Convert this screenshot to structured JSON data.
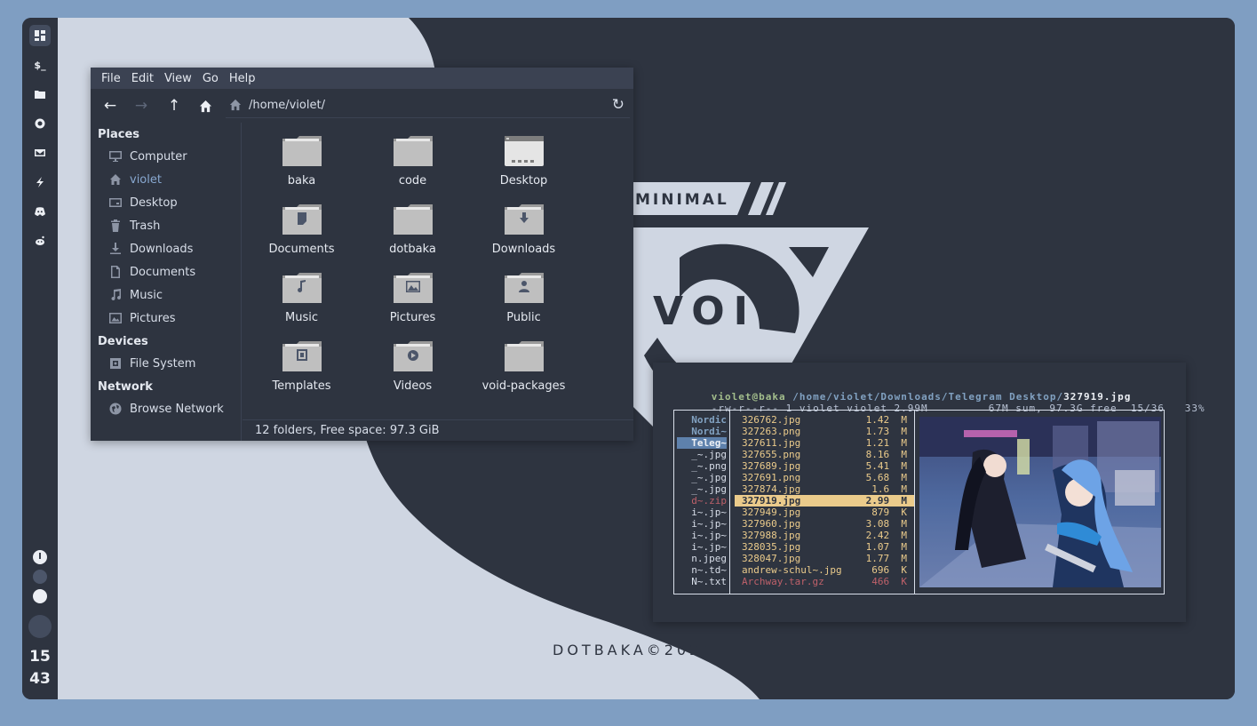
{
  "colors": {
    "frame": "#7f9ec2",
    "panel": "#2e3440",
    "light": "#cfd6e2",
    "accent": "#88a8d0",
    "yellow": "#ebcb8b",
    "red": "#bf616a"
  },
  "bar": {
    "buttons": [
      {
        "icon": "dashboard-icon"
      },
      {
        "icon": "terminal-icon",
        "text": "$_"
      },
      {
        "icon": "folder-icon"
      },
      {
        "icon": "settings-icon"
      },
      {
        "icon": "mail-icon"
      },
      {
        "icon": "bolt-icon"
      },
      {
        "icon": "discord-icon"
      },
      {
        "icon": "reddit-icon"
      }
    ],
    "status_icon": "I",
    "clock_hour": "15",
    "clock_minute": "43"
  },
  "wallpaper": {
    "tagline": "MINIMAL",
    "logo_text": "VOID",
    "credit": "DOTBAKA©2021"
  },
  "fm": {
    "menu": [
      "File",
      "Edit",
      "View",
      "Go",
      "Help"
    ],
    "toolbar": {
      "back": "←",
      "forward": "→",
      "up": "↑",
      "reload": "↻"
    },
    "path": "/home/violet/",
    "sidebar": {
      "places_label": "Places",
      "places": [
        {
          "label": "Computer",
          "icon": "computer-icon"
        },
        {
          "label": "violet",
          "icon": "home-icon"
        },
        {
          "label": "Desktop",
          "icon": "desktop-icon"
        },
        {
          "label": "Trash",
          "icon": "trash-icon"
        },
        {
          "label": "Downloads",
          "icon": "download-icon"
        },
        {
          "label": "Documents",
          "icon": "document-icon"
        },
        {
          "label": "Music",
          "icon": "music-icon"
        },
        {
          "label": "Pictures",
          "icon": "picture-icon"
        }
      ],
      "devices_label": "Devices",
      "devices": [
        {
          "label": "File System",
          "icon": "drive-icon"
        }
      ],
      "network_label": "Network",
      "network": [
        {
          "label": "Browse Network",
          "icon": "network-icon"
        }
      ]
    },
    "folders": [
      {
        "name": "baka",
        "emblem": ""
      },
      {
        "name": "code",
        "emblem": ""
      },
      {
        "name": "Desktop",
        "emblem": "desktop"
      },
      {
        "name": "Documents",
        "emblem": "document"
      },
      {
        "name": "dotbaka",
        "emblem": ""
      },
      {
        "name": "Downloads",
        "emblem": "download"
      },
      {
        "name": "Music",
        "emblem": "music"
      },
      {
        "name": "Pictures",
        "emblem": "picture"
      },
      {
        "name": "Public",
        "emblem": "user"
      },
      {
        "name": "Templates",
        "emblem": "template"
      },
      {
        "name": "Videos",
        "emblem": "video"
      },
      {
        "name": "void-packages",
        "emblem": ""
      }
    ],
    "status": "12 folders, Free space: 97.3 GiB"
  },
  "term": {
    "user": "violet@baka",
    "cwd": "/home/violet/Downloads/Telegram Desktop/",
    "file": "327919.jpg",
    "perms": "-rw-r--r-- 1 violet violet 2.99M",
    "summary": "67M sum, 97.3G free  15/36   33%",
    "parents": [
      {
        "name": "Nordic",
        "style": "dir"
      },
      {
        "name": "Nordi~",
        "style": "dir"
      },
      {
        "name": "Teleg~",
        "style": "dir-sel"
      },
      {
        "name": "_~.jpg",
        "style": "file"
      },
      {
        "name": "_~.png",
        "style": "file"
      },
      {
        "name": "_~.jpg",
        "style": "file"
      },
      {
        "name": "_~.jpg",
        "style": "file"
      },
      {
        "name": "d~.zip",
        "style": "archive"
      },
      {
        "name": "i~.jp~",
        "style": "file"
      },
      {
        "name": "i~.jp~",
        "style": "file"
      },
      {
        "name": "i~.jp~",
        "style": "file"
      },
      {
        "name": "i~.jp~",
        "style": "file"
      },
      {
        "name": "n.jpeg",
        "style": "file"
      },
      {
        "name": "n~.td~",
        "style": "file"
      },
      {
        "name": "N~.txt",
        "style": "file"
      }
    ],
    "files": [
      {
        "name": "326762.jpg",
        "size": "1.42  M",
        "style": "img"
      },
      {
        "name": "327263.png",
        "size": "1.73  M",
        "style": "img"
      },
      {
        "name": "327611.jpg",
        "size": "1.21  M",
        "style": "img"
      },
      {
        "name": "327655.png",
        "size": "8.16  M",
        "style": "img"
      },
      {
        "name": "327689.jpg",
        "size": "5.41  M",
        "style": "img"
      },
      {
        "name": "327691.png",
        "size": "5.68  M",
        "style": "img"
      },
      {
        "name": "327874.jpg",
        "size": "1.6  M",
        "style": "img"
      },
      {
        "name": "327919.jpg",
        "size": "2.99  M",
        "style": "sel"
      },
      {
        "name": "327949.jpg",
        "size": "879  K",
        "style": "img"
      },
      {
        "name": "327960.jpg",
        "size": "3.08  M",
        "style": "img"
      },
      {
        "name": "327988.jpg",
        "size": "2.42  M",
        "style": "img"
      },
      {
        "name": "328035.jpg",
        "size": "1.07  M",
        "style": "img"
      },
      {
        "name": "328047.jpg",
        "size": "1.77  M",
        "style": "img"
      },
      {
        "name": "andrew-schul~.jpg",
        "size": "696  K",
        "style": "img"
      },
      {
        "name": "Archway.tar.gz",
        "size": "466  K",
        "style": "archive"
      }
    ]
  }
}
